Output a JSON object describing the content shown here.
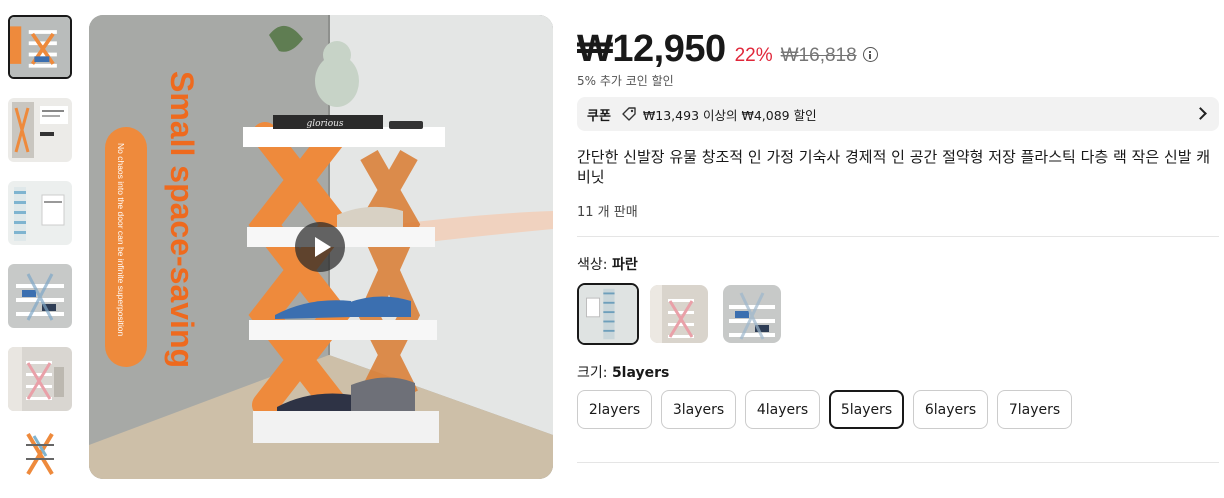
{
  "gallery": {
    "main_image_text": {
      "headline": "Small space-saving",
      "tagline": "No chaos into the door can be infinite superposition",
      "book": "glorious"
    },
    "thumbnails": [
      {
        "name": "thumbnail-1",
        "active": true
      },
      {
        "name": "thumbnail-2",
        "active": false
      },
      {
        "name": "thumbnail-3",
        "active": false
      },
      {
        "name": "thumbnail-4",
        "active": false
      },
      {
        "name": "thumbnail-5",
        "active": false
      },
      {
        "name": "thumbnail-6",
        "active": false
      }
    ]
  },
  "price": {
    "current": "₩12,950",
    "discount": "22%",
    "original": "₩16,818",
    "coin_note": "5% 추가 코인 할인"
  },
  "coupon": {
    "label": "쿠폰",
    "text": "₩13,493 이상의 ₩4,089 할인"
  },
  "product": {
    "title": "간단한 신발장 유물 창조적 인 가정 기숙사 경제적 인 공간 절약형 저장 플라스틱 다층 랙 작은 신발 캐비닛",
    "sold": "11 개 판매"
  },
  "color": {
    "label": "색상: ",
    "value": "파란",
    "options": [
      "color-option-1",
      "color-option-2",
      "color-option-3"
    ]
  },
  "size": {
    "label": "크기: ",
    "value": "5layers",
    "options": [
      "2layers",
      "3layers",
      "4layers",
      "5layers",
      "6layers",
      "7layers"
    ],
    "selected": "5layers"
  },
  "colors": {
    "accent_orange": "#ee8a3c",
    "discount_red": "#e0273a",
    "coupon_bg": "#f2f2f2"
  }
}
